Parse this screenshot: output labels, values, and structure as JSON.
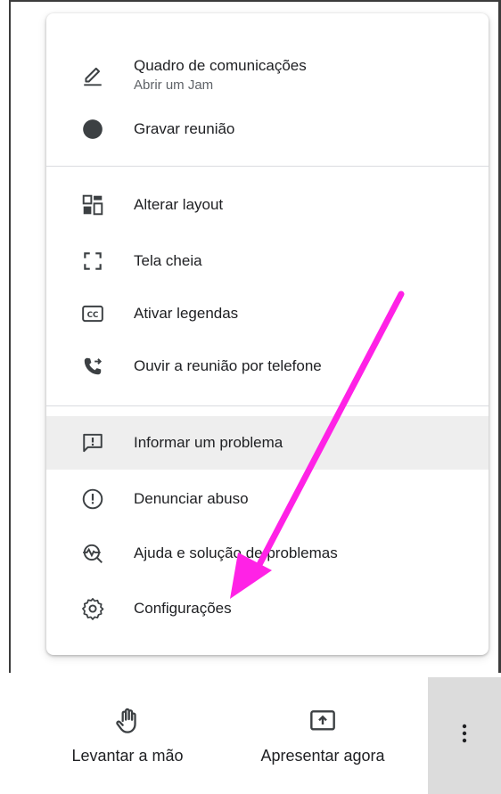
{
  "menu": {
    "items": [
      {
        "icon": "pen-icon",
        "label": "Quadro de comunicações",
        "sublabel": "Abrir um Jam"
      },
      {
        "icon": "record-dot-icon",
        "label": "Gravar reunião"
      },
      {
        "icon": "layout-icon",
        "label": "Alterar layout"
      },
      {
        "icon": "fullscreen-icon",
        "label": "Tela cheia"
      },
      {
        "icon": "captions-icon",
        "label": "Ativar legendas"
      },
      {
        "icon": "phone-forward-icon",
        "label": "Ouvir a reunião por telefone"
      },
      {
        "icon": "feedback-icon",
        "label": "Informar um problema"
      },
      {
        "icon": "alert-circle-icon",
        "label": "Denunciar abuso"
      },
      {
        "icon": "troubleshoot-icon",
        "label": "Ajuda e solução de problemas"
      },
      {
        "icon": "gear-icon",
        "label": "Configurações"
      }
    ],
    "highlighted_item": "Informar um problema"
  },
  "bottom_bar": {
    "raise_hand_label": "Levantar a mão",
    "present_label": "Apresentar agora",
    "more_icon": "more-vertical-icon"
  },
  "colors": {
    "annotation_arrow": "#ff22e6",
    "highlight_bg": "#eeeeee",
    "more_button_bg": "#dcdcdc",
    "text_primary": "#202124",
    "text_secondary": "#5f6368"
  }
}
